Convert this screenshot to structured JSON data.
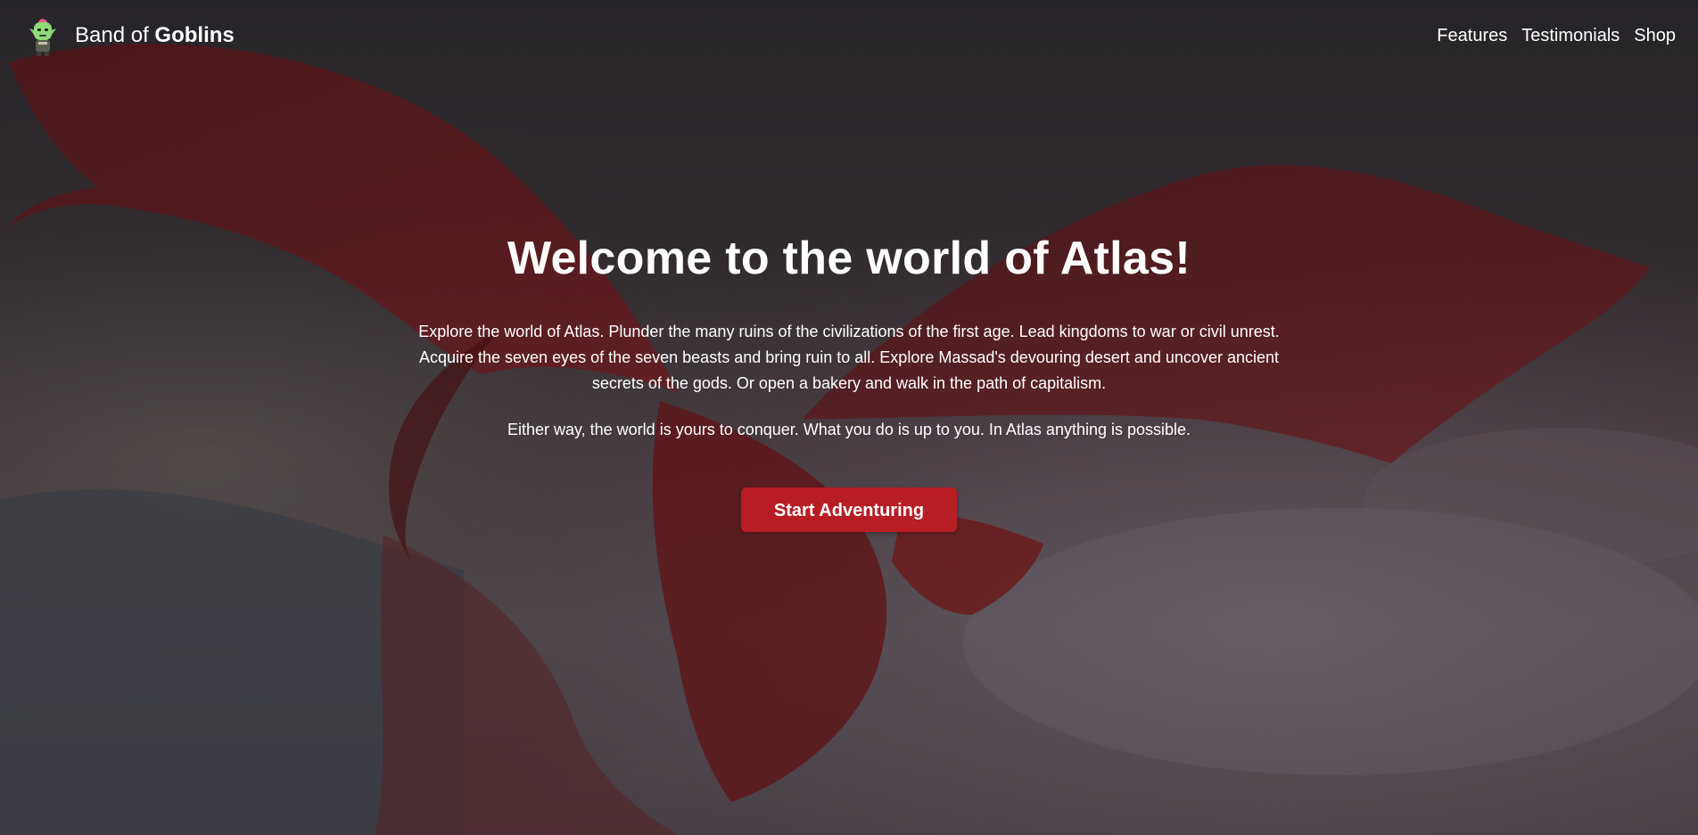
{
  "brand": {
    "name_prefix": "Band of",
    "name_bold": "Goblins",
    "logo_icon": "goblin-icon"
  },
  "nav": {
    "links": [
      {
        "label": "Features"
      },
      {
        "label": "Testimonials"
      },
      {
        "label": "Shop"
      }
    ]
  },
  "hero": {
    "background_image": "red-dragon-over-clouds",
    "headline": "Welcome to the world of Atlas!",
    "intro": "Explore the world of Atlas. Plunder the many ruins of the civilizations of the first age. Lead kingdoms to war or civil unrest. Acquire the seven eyes of the seven beasts and bring ruin to all. Explore Massad's devouring desert and uncover ancient secrets of the gods. Or open a bakery and walk in the path of capitalism.",
    "tagline": "Either way, the world is yours to conquer. What you do is up to you. In Atlas anything is possible.",
    "cta_label": "Start Adventuring"
  },
  "colors": {
    "accent": "#b81d24",
    "text": "#ffffff"
  }
}
